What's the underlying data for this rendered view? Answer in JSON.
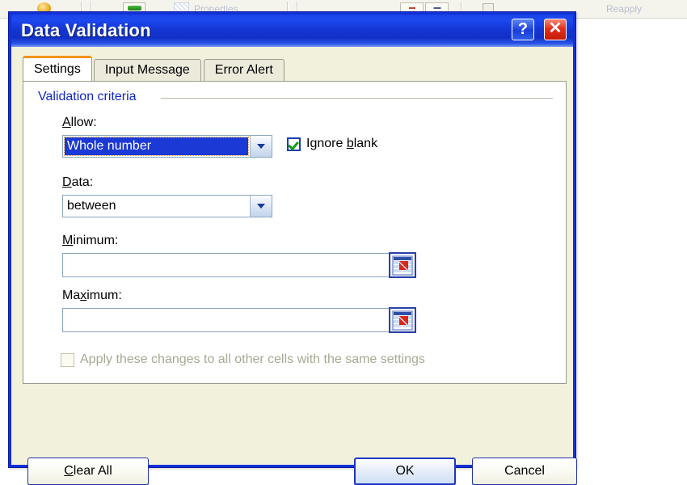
{
  "backdrop": {
    "properties_label": "Properties",
    "reapply_label": "Reapply",
    "globe_icon": "globe-icon",
    "green_icon": "green-bar-icon",
    "hatch_icon": "hatched-cell-icon",
    "page_icon": "page-icon"
  },
  "dialog": {
    "title": "Data Validation",
    "help_button": "?",
    "close_button": "✕",
    "help_icon": "question-mark-icon",
    "close_icon": "close-x-icon",
    "frame_color": "#1330d8",
    "body_color": "#f2f1dc"
  },
  "tabs": [
    {
      "label": "Settings",
      "active": true
    },
    {
      "label": "Input Message",
      "active": false
    },
    {
      "label": "Error Alert",
      "active": false
    }
  ],
  "settings_tab": {
    "group_heading": "Validation criteria",
    "group_heading_color": "#1128c4",
    "allow": {
      "label_pre": "",
      "label_key": "A",
      "label_post": "llow:",
      "value": "Whole number",
      "focused": true,
      "dropdown_icon": "chevron-down-icon"
    },
    "ignore_blank": {
      "label_pre": "Ignore ",
      "label_key": "b",
      "label_post": "lank",
      "checked": true,
      "check_icon": "green-check-icon",
      "check_color": "#139b13"
    },
    "data": {
      "label_pre": "",
      "label_key": "D",
      "label_post": "ata:",
      "value": "between",
      "focused": false,
      "dropdown_icon": "chevron-down-icon"
    },
    "minimum": {
      "label_pre": "",
      "label_key": "M",
      "label_post": "inimum:",
      "value": "",
      "picker_icon": "range-selector-icon"
    },
    "maximum": {
      "label_pre": "Ma",
      "label_key": "x",
      "label_post": "imum:",
      "value": "",
      "picker_icon": "range-selector-icon"
    },
    "apply_all": {
      "label": "Apply these changes to all other cells with the same settings",
      "checked": false,
      "disabled": true
    }
  },
  "footer": {
    "clear_all": {
      "pre": "C",
      "key": "C",
      "post": "lear All",
      "label": "Clear All"
    },
    "ok": {
      "label": "OK",
      "default": true
    },
    "cancel": {
      "label": "Cancel"
    }
  }
}
